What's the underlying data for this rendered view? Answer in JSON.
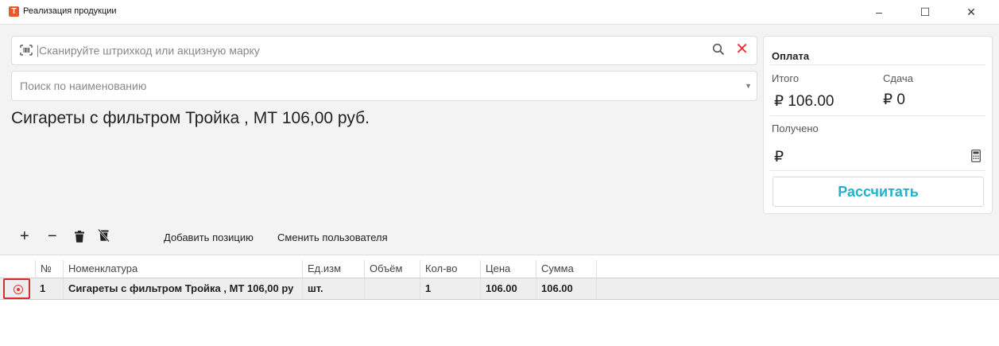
{
  "window": {
    "title": "Реализация продукции",
    "app_icon_letter": "Т",
    "minimize": "–",
    "maximize": "☐",
    "close": "✕"
  },
  "scan": {
    "placeholder": "Сканируйте штрихкод или акцизную марку"
  },
  "name_search": {
    "placeholder": "Поиск по наименованию"
  },
  "product_title": "Сигареты с фильтром Тройка , МТ 106,00 руб.",
  "payment": {
    "header": "Оплата",
    "total_label": "Итого",
    "total_value": "₽ 106.00",
    "change_label": "Сдача",
    "change_value": "₽ 0",
    "received_label": "Получено",
    "received_value": "₽",
    "calculate_button": "Рассчитать"
  },
  "toolbar": {
    "add_icon": "+",
    "remove_icon": "−",
    "add_position": "Добавить позицию",
    "change_user": "Сменить пользователя"
  },
  "table": {
    "columns": [
      "№",
      "Номенклатура",
      "Ед.изм",
      "Объём",
      "Кол-во",
      "Цена",
      "Сумма"
    ],
    "rows": [
      {
        "num": "1",
        "name": "Сигареты с фильтром Тройка , МТ 106,00 ру",
        "unit": "шт.",
        "volume": "",
        "qty": "1",
        "price": "106.00",
        "sum": "106.00"
      }
    ]
  },
  "colors": {
    "accent": "#1fb3c9",
    "danger": "#e53935",
    "app_icon": "#e8592a"
  }
}
